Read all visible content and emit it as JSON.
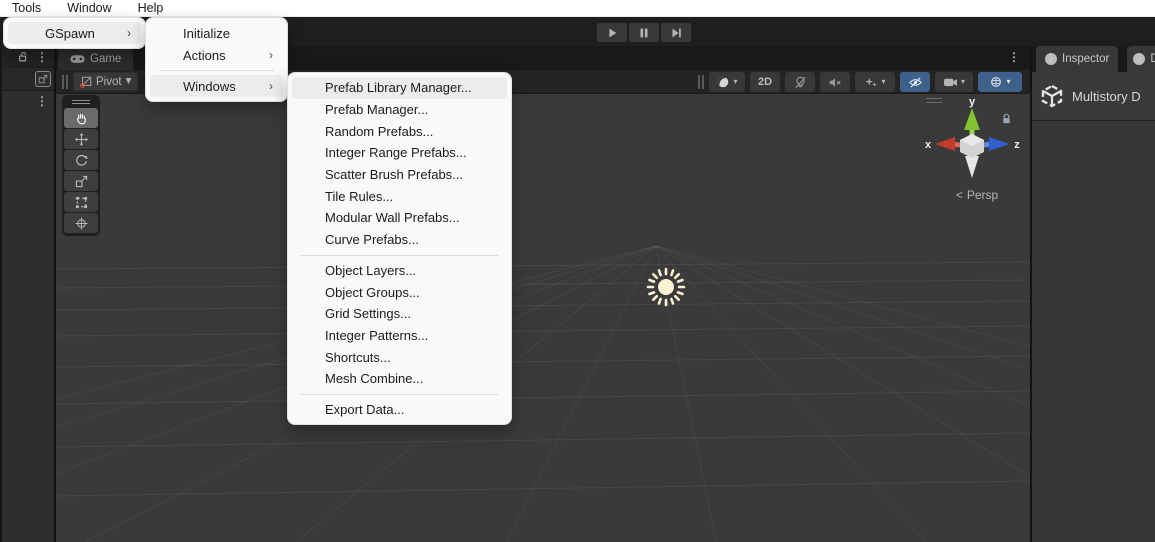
{
  "menubar": {
    "items": [
      "Tools",
      "Window",
      "Help"
    ]
  },
  "menus": {
    "tools": {
      "gspawn_label": "GSpawn"
    },
    "gspawn": {
      "initialize": "Initialize",
      "actions": "Actions",
      "windows": "Windows"
    },
    "windows": {
      "group1": [
        "Prefab Library Manager...",
        "Prefab Manager...",
        "Random Prefabs...",
        "Integer Range Prefabs...",
        "Scatter Brush Prefabs...",
        "Tile Rules...",
        "Modular Wall Prefabs...",
        "Curve Prefabs..."
      ],
      "group2": [
        "Object Layers...",
        "Object Groups...",
        "Grid Settings...",
        "Integer Patterns...",
        "Shortcuts...",
        "Mesh Combine..."
      ],
      "group3": [
        "Export Data..."
      ]
    }
  },
  "scene": {
    "tab_label": "Game",
    "pivot_label": "Pivot",
    "toggle_2d_label": "2D",
    "persp_label": "Persp",
    "axis_labels": {
      "x": "x",
      "y": "y",
      "z": "z"
    }
  },
  "inspector": {
    "tab_label": "Inspector",
    "tab2_label": "D",
    "object_name": "Multistory D"
  },
  "glyphs": {
    "submenu_arrow": "›",
    "caret": "▾",
    "kebab": "⋮",
    "persp_chevron": "<"
  },
  "colors": {
    "toggle_active_blue": "#3e618c",
    "menu_bg": "#f9f9f9",
    "menu_highlight": "#ececec",
    "viewport_bg": "#3a3a3a",
    "sun_gizmo": "#fdf3d3",
    "axis_x_red": "#c23b2e",
    "axis_y_green": "#82c32f",
    "axis_z_blue": "#2f5fd0"
  }
}
